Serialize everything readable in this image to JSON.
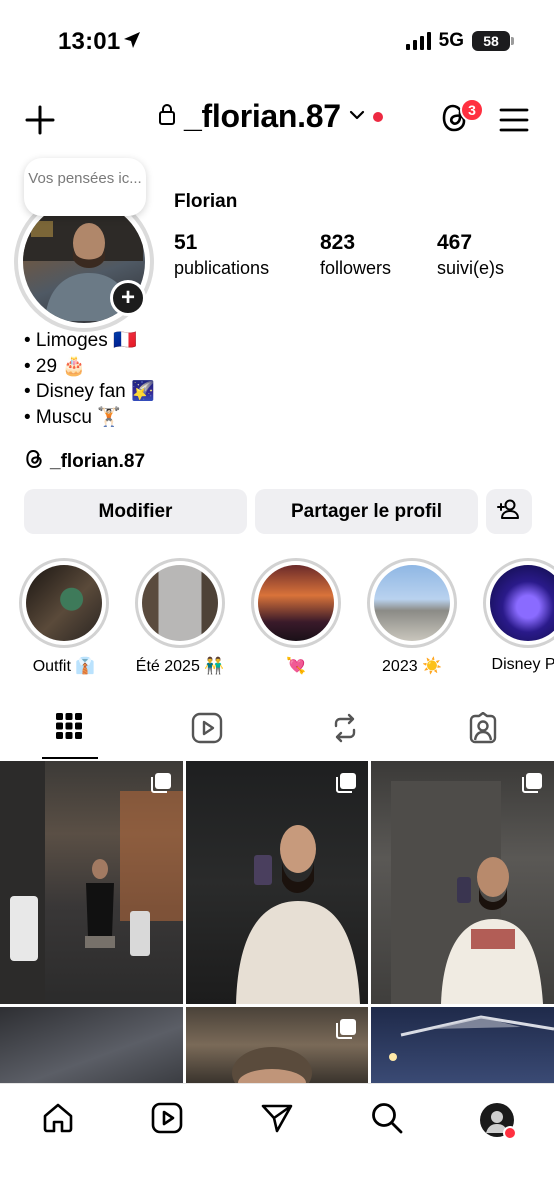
{
  "status_bar": {
    "time": "13:01",
    "network": "5G",
    "battery": "58"
  },
  "header": {
    "username": "_florian.87",
    "threads_badge": "3"
  },
  "profile": {
    "note_text": "Vos pensées ic...",
    "display_name": "Florian",
    "stats": [
      {
        "value": "51",
        "label": "publications"
      },
      {
        "value": "823",
        "label": "followers"
      },
      {
        "value": "467",
        "label": "suivi(e)s"
      }
    ],
    "bio_lines": [
      "• Limoges 🇫🇷",
      "• 29 🎂",
      "• Disney fan 🌠",
      "• Muscu 🏋🏻"
    ],
    "threads_handle": "_florian.87"
  },
  "actions": {
    "edit_label": "Modifier",
    "share_label": "Partager le profil"
  },
  "highlights": [
    {
      "label": "Outfit 👔"
    },
    {
      "label": "Été 2025 👬"
    },
    {
      "label": "💘"
    },
    {
      "label": "2023 ☀️"
    },
    {
      "label": "Disney Pa"
    }
  ],
  "tabs": [
    "grid",
    "reels",
    "reposts",
    "tagged"
  ],
  "active_tab": "grid",
  "bottom_nav": [
    "home",
    "reels",
    "direct",
    "search",
    "profile"
  ]
}
